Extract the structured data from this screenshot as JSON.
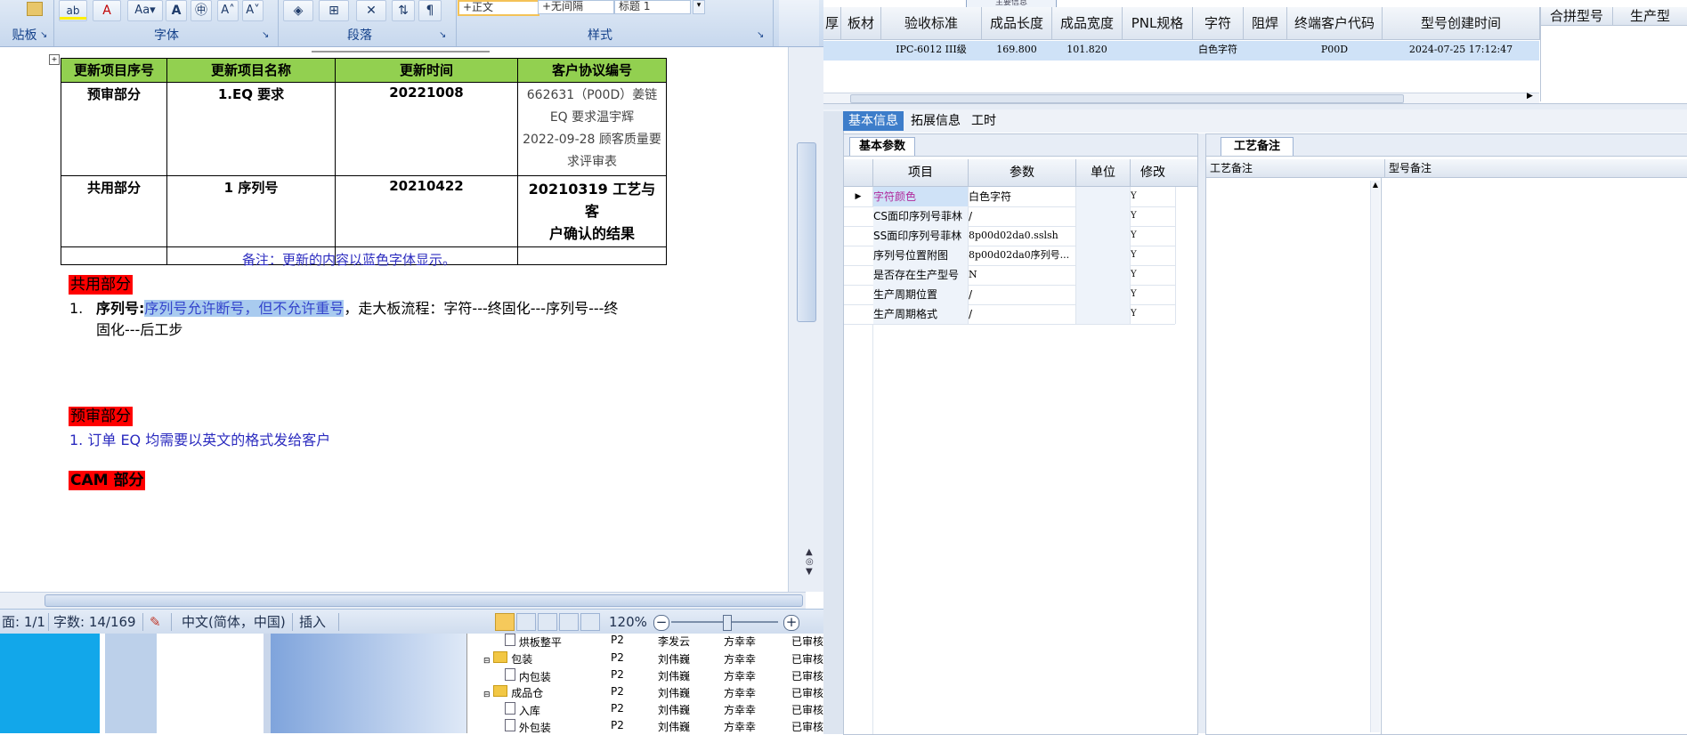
{
  "ribbon": {
    "groups": [
      "贴板",
      "字体",
      "段落",
      "样式"
    ],
    "styles": [
      "+正文",
      "+无间隔",
      "标题 1"
    ]
  },
  "doc": {
    "table_headers": [
      "更新项目序号",
      "更新项目名称",
      "更新时间",
      "客户协议编号"
    ],
    "rows": [
      {
        "no": "预审部分",
        "name": "1.EQ 要求",
        "time": "20221008",
        "code_lines": [
          "662631（P00D）姜链",
          "EQ 要求温宇辉",
          "2022-09-28 顾客质量要",
          "求评审表"
        ]
      },
      {
        "no": "共用部分",
        "name": "1 序列号",
        "time": "20210422",
        "code_lines": [
          "20210319 工艺与客",
          "户确认的结果"
        ]
      }
    ],
    "note": "备注：更新的内容以蓝色字体显示。",
    "section_common": "共用部分",
    "item1_prefix": "1.",
    "item1_label": "序列号:",
    "item1_highlight": "序列号允许断号，但不允许重号",
    "item1_rest": "，走大板流程：字符---终固化---序列号---终",
    "item1_line2": "固化---后工步",
    "section_pre": "预审部分",
    "item2": "1. 订单 EQ 均需要以英文的格式发给客户",
    "section_cam": "CAM 部分"
  },
  "status": {
    "page": "面: 1/1",
    "words": "字数: 14/169",
    "lang": "中文(简体，中国)",
    "mode": "插入",
    "zoom": "120%"
  },
  "tree": {
    "rows": [
      {
        "name": "烘板整平",
        "p": "P2",
        "a": "李发云",
        "b": "方幸幸",
        "s": "已审核"
      },
      {
        "name": "包装",
        "p": "P2",
        "a": "刘伟巍",
        "b": "方幸幸",
        "s": "已审核"
      },
      {
        "name": "内包装",
        "p": "P2",
        "a": "刘伟巍",
        "b": "方幸幸",
        "s": "已审核"
      },
      {
        "name": "成品仓",
        "p": "P2",
        "a": "刘伟巍",
        "b": "方幸幸",
        "s": "已审核"
      },
      {
        "name": "入库",
        "p": "P2",
        "a": "刘伟巍",
        "b": "方幸幸",
        "s": "已审核"
      },
      {
        "name": "外包装",
        "p": "P2",
        "a": "刘伟巍",
        "b": "方幸幸",
        "s": "已审核"
      }
    ]
  },
  "erp": {
    "top_label": "主要信息",
    "grid_headers": [
      "厚",
      "板材",
      "验收标准",
      "成品长度",
      "成品宽度",
      "PNL规格",
      "字符",
      "阻焊",
      "终端客户代码",
      "型号创建时间"
    ],
    "grid_row": [
      "",
      "",
      "IPC-6012 III级",
      "169.800",
      "101.820",
      "",
      "白色字符",
      "",
      "P00D",
      "2024-07-25 17:12:47"
    ],
    "side_headers": [
      "合拼型号",
      "生产型"
    ],
    "tabs": [
      "基本信息",
      "拓展信息",
      "工时"
    ],
    "subtab_left": "基本参数",
    "subtab_right": "工艺备注",
    "param_headers": [
      "项目",
      "参数",
      "单位",
      "修改"
    ],
    "params": [
      {
        "item": "字符颜色",
        "value": "白色字符",
        "unit": "",
        "mod": "Y"
      },
      {
        "item": "CS面印序列号菲林",
        "value": "/",
        "unit": "",
        "mod": "Y"
      },
      {
        "item": "SS面印序列号菲林",
        "value": "8p00d02da0.sslsh",
        "unit": "",
        "mod": "Y"
      },
      {
        "item": "序列号位置附图",
        "value": "8p00d02da0序列号...",
        "unit": "",
        "mod": "Y"
      },
      {
        "item": "是否存在生产型号",
        "value": "N",
        "unit": "",
        "mod": "Y"
      },
      {
        "item": "生产周期位置",
        "value": "/",
        "unit": "",
        "mod": "Y"
      },
      {
        "item": "生产周期格式",
        "value": "/",
        "unit": "",
        "mod": "Y"
      }
    ],
    "remark_headers": [
      "工艺备注",
      "型号备注"
    ]
  },
  "colors": {
    "red_tag": "#ff0000",
    "table_head": "#92d050",
    "selected_row": "#cfe2f7",
    "accent_tab": "#3d7dca"
  }
}
